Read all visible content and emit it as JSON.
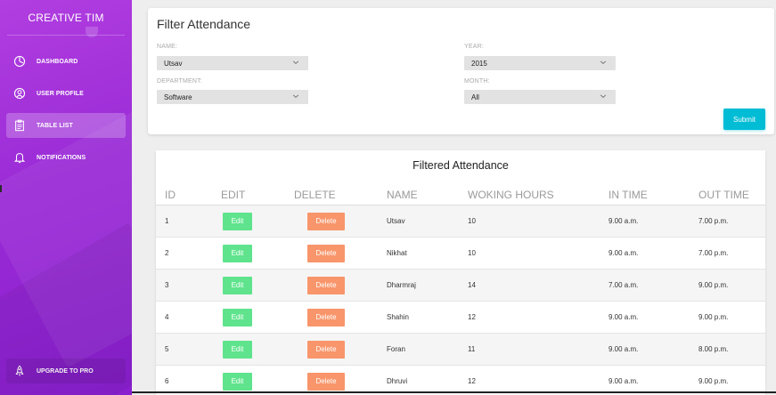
{
  "sidebar": {
    "brand": "CREATIVE TIM",
    "items": [
      {
        "label": "DASHBOARD",
        "icon": "dashboard-icon"
      },
      {
        "label": "USER PROFILE",
        "icon": "user-icon"
      },
      {
        "label": "TABLE LIST",
        "icon": "clipboard-icon",
        "active": true
      },
      {
        "label": "NOTIFICATIONS",
        "icon": "bell-icon"
      }
    ],
    "upgrade": {
      "label": "UPGRADE TO PRO",
      "icon": "rocket-icon"
    }
  },
  "filter": {
    "title": "Filter Attendance",
    "name_label": "NAME:",
    "name_value": "Utsav",
    "year_label": "YEAR:",
    "year_value": "2015",
    "department_label": "DEPARTMENT:",
    "department_value": "Software",
    "month_label": "MONTH:",
    "month_value": "All",
    "submit_label": "Submit"
  },
  "table": {
    "title": "Filtered Attendance",
    "headers": [
      "ID",
      "EDIT",
      "DELETE",
      "NAME",
      "WOKING HOURS",
      "IN TIME",
      "OUT TIME"
    ],
    "edit_label": "Edit",
    "delete_label": "Delete",
    "rows": [
      {
        "id": "1",
        "name": "Utsav",
        "hours": "10",
        "in": "9.00 a.m.",
        "out": "7.00 p.m."
      },
      {
        "id": "2",
        "name": "Nikhat",
        "hours": "10",
        "in": "9.00 a.m.",
        "out": "7.00 p.m."
      },
      {
        "id": "3",
        "name": "Dharmraj",
        "hours": "14",
        "in": "7.00 a.m.",
        "out": "9.00 p.m."
      },
      {
        "id": "4",
        "name": "Shahin",
        "hours": "12",
        "in": "9.00 a.m.",
        "out": "9.00 p.m."
      },
      {
        "id": "5",
        "name": "Foran",
        "hours": "11",
        "in": "9.00 a.m.",
        "out": "8.00 p.m."
      },
      {
        "id": "6",
        "name": "Dhruvi",
        "hours": "12",
        "in": "9.00 a.m.",
        "out": "9.00 p.m."
      }
    ]
  },
  "colors": {
    "sidebar": "#9a2bd6",
    "submit": "#00bcd4",
    "edit": "#5fe38d",
    "delete": "#f8956b"
  }
}
